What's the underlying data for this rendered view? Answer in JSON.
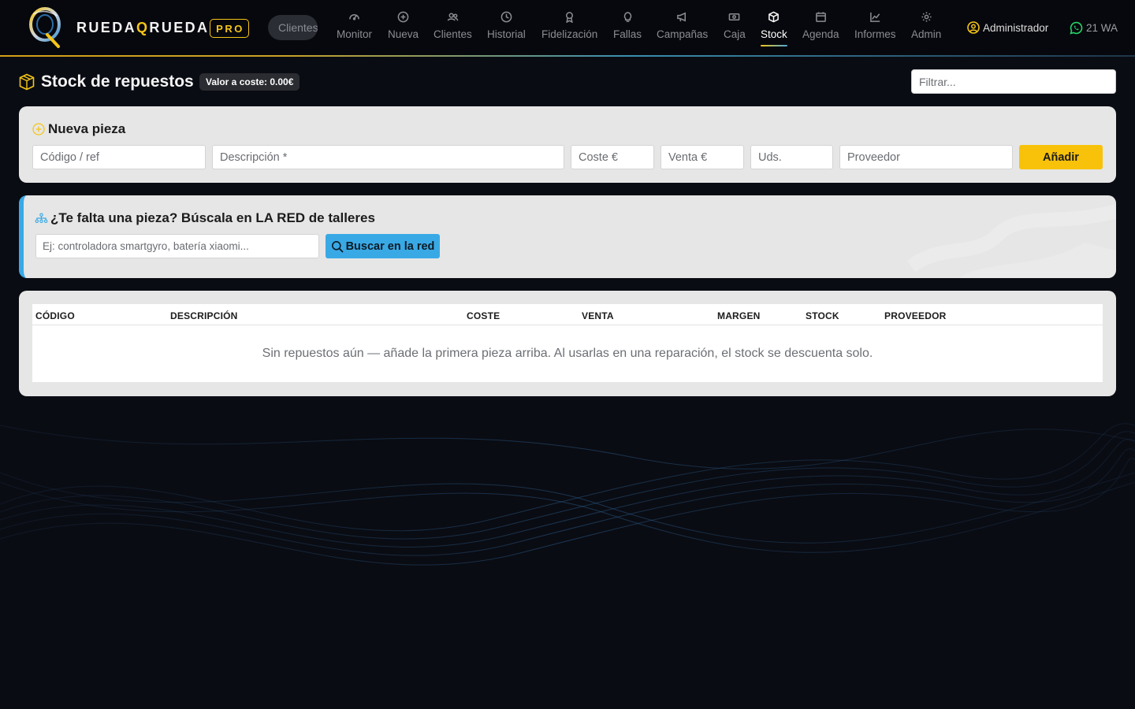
{
  "brand": {
    "name_a": "RUEDA",
    "name_q": "Q",
    "name_b": "RUEDA",
    "badge": "PRO",
    "accent": "#f5c518"
  },
  "nav": {
    "search_placeholder": "Clientes",
    "items": [
      {
        "label": "Monitor",
        "icon": "gauge-icon"
      },
      {
        "label": "Nueva",
        "icon": "plus-circle-icon"
      },
      {
        "label": "Clientes",
        "icon": "users-icon"
      },
      {
        "label": "Historial",
        "icon": "clock-icon"
      },
      {
        "label": "Fidelización",
        "icon": "award-icon"
      },
      {
        "label": "Fallas",
        "icon": "lightbulb-icon"
      },
      {
        "label": "Campañas",
        "icon": "megaphone-icon"
      },
      {
        "label": "Caja",
        "icon": "cash-icon"
      },
      {
        "label": "Stock",
        "icon": "box-icon",
        "active": true
      },
      {
        "label": "Agenda",
        "icon": "calendar-icon"
      },
      {
        "label": "Informes",
        "icon": "chart-line-icon"
      },
      {
        "label": "Admin",
        "icon": "gear-icon"
      }
    ],
    "user": "Administrador",
    "whatsapp": "21 WA"
  },
  "page": {
    "title": "Stock de repuestos",
    "value_badge": "Valor a coste: 0.00€",
    "filter_placeholder": "Filtrar..."
  },
  "new_part": {
    "title": "Nueva pieza",
    "fields": {
      "code": "Código / ref",
      "description": "Descripción *",
      "cost": "Coste €",
      "sale": "Venta €",
      "units": "Uds.",
      "supplier": "Proveedor"
    },
    "add_label": "Añadir"
  },
  "network": {
    "title": "¿Te falta una pieza? Búscala en LA RED de talleres",
    "search_placeholder": "Ej: controladora smartgyro, batería xiaomi...",
    "button_label": "Buscar en la red",
    "accent": "#39a9e6"
  },
  "table": {
    "columns": [
      "CÓDIGO",
      "DESCRIPCIÓN",
      "COSTE",
      "VENTA",
      "MARGEN",
      "STOCK",
      "PROVEEDOR"
    ],
    "rows": [],
    "empty_message": "Sin repuestos aún — añade la primera pieza arriba. Al usarlas en una reparación, el stock se descuenta solo."
  }
}
